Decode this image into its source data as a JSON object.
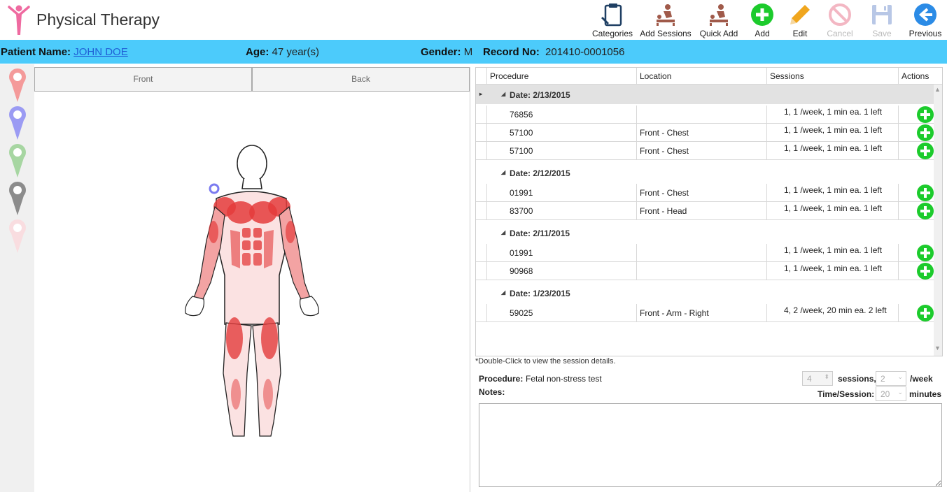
{
  "app": {
    "title": "Physical Therapy"
  },
  "toolbar": {
    "categories": "Categories",
    "add_sessions": "Add Sessions",
    "quick_add": "Quick Add",
    "add": "Add",
    "edit": "Edit",
    "cancel": "Cancel",
    "save": "Save",
    "previous": "Previous"
  },
  "patient": {
    "name_label": "Patient Name:",
    "name": "JOHN DOE",
    "age_label": "Age:",
    "age": "47 year(s)",
    "gender_label": "Gender:",
    "gender": "M",
    "record_label": "Record No:",
    "record": "201410-0001056"
  },
  "body_view": {
    "front_tab": "Front",
    "back_tab": "Back"
  },
  "pins": [
    "pink-pin-icon",
    "purple-pin-icon",
    "green-pin-icon",
    "gray-pin-icon",
    "light-pink-pin-icon"
  ],
  "grid": {
    "columns": [
      "Procedure",
      "Location",
      "Sessions",
      "Actions"
    ],
    "groups": [
      {
        "date": "Date: 2/13/2015",
        "rows": [
          {
            "procedure": "76856",
            "location": "",
            "sessions": "1, 1 /week, 1 min ea.  1 left"
          },
          {
            "procedure": "57100",
            "location": "Front - Chest",
            "sessions": "1, 1 /week, 1 min ea.  1 left"
          },
          {
            "procedure": "57100",
            "location": "Front - Chest",
            "sessions": "1, 1 /week, 1 min ea.  1 left"
          }
        ]
      },
      {
        "date": "Date: 2/12/2015",
        "rows": [
          {
            "procedure": "01991",
            "location": "Front - Chest",
            "sessions": "1, 1 /week, 1 min ea.  1 left"
          },
          {
            "procedure": "83700",
            "location": "Front - Head",
            "sessions": "1, 1 /week, 1 min ea.  1 left"
          }
        ]
      },
      {
        "date": "Date: 2/11/2015",
        "rows": [
          {
            "procedure": "01991",
            "location": "",
            "sessions": "1, 1 /week, 1 min ea.  1 left"
          },
          {
            "procedure": "90968",
            "location": "",
            "sessions": "1, 1 /week, 1 min ea.  1 left"
          }
        ]
      },
      {
        "date": "Date: 1/23/2015",
        "rows": [
          {
            "procedure": "59025",
            "location": "Front - Arm - Right",
            "sessions": "4, 2 /week, 20 min ea.  2 left"
          }
        ]
      }
    ]
  },
  "details": {
    "hint": "*Double-Click to view the session details.",
    "procedure_label": "Procedure:",
    "procedure_value": "Fetal non-stress test",
    "notes_label": "Notes:",
    "sessions_value": "4",
    "sessions_label": "sessions,",
    "per_week_value": "2",
    "per_week_label": "/week",
    "time_label": "Time/Session:",
    "time_value": "20",
    "time_unit": "minutes"
  },
  "colors": {
    "accent_bar": "#4ccbfb",
    "add_green": "#1ccb2c",
    "muscle_red": "#e43c3c"
  }
}
